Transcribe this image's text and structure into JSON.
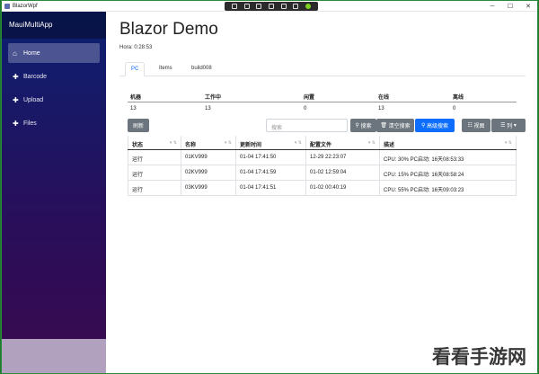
{
  "window": {
    "title": "BlazorWpf"
  },
  "sidebar": {
    "brand": "MauiMultiApp",
    "items": [
      {
        "label": "Home",
        "icon": "home-icon"
      },
      {
        "label": "Barcode",
        "icon": "plus-icon"
      },
      {
        "label": "Upload",
        "icon": "plus-icon"
      },
      {
        "label": "Files",
        "icon": "plus-icon"
      }
    ]
  },
  "main": {
    "title": "Blazor Demo",
    "hora": "Hora: 0:28:53",
    "tabs": [
      "PC",
      "Items",
      "build008"
    ],
    "stats": {
      "headers": [
        "机器",
        "工作中",
        "闲置",
        "在线",
        "离线"
      ],
      "values": [
        "13",
        "13",
        "0",
        "13",
        "0"
      ]
    },
    "toolbar": {
      "refresh": "刷新",
      "search_placeholder": "搜索",
      "search": "搜索",
      "clear": "清空搜索",
      "advanced": "高级搜索",
      "view": "视图",
      "columns": "列"
    },
    "grid": {
      "headers": [
        "状态",
        "名称",
        "更新时间",
        "配置文件",
        "描述"
      ],
      "rows": [
        [
          "运行",
          "01KV999",
          "01-04 17:41:50",
          "12-29 22:23:07",
          "CPU: 30% PC启动: 16天08:53:33"
        ],
        [
          "运行",
          "02KV999",
          "01-04 17:41:59",
          "01-02 12:59:04",
          "CPU: 15% PC启动: 16天08:58:24"
        ],
        [
          "运行",
          "03KV999",
          "01-04 17:41:51",
          "01-02 00:40:19",
          "CPU: 55% PC启动: 16天09:03:23"
        ]
      ]
    }
  },
  "watermark": "看看手游网"
}
